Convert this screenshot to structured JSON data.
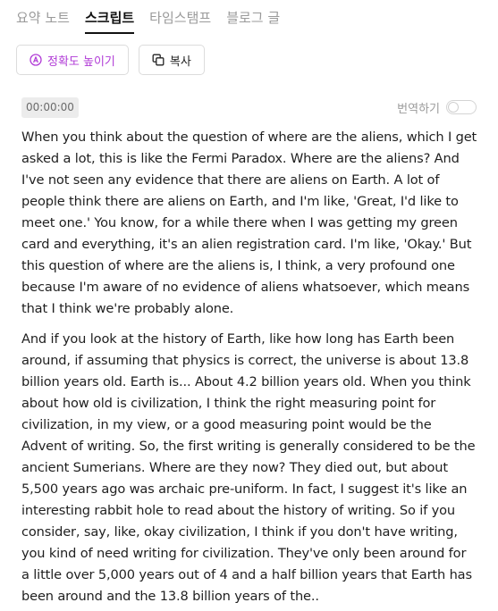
{
  "tabs": [
    {
      "label": "요약 노트",
      "active": false
    },
    {
      "label": "스크립트",
      "active": true
    },
    {
      "label": "타임스탬프",
      "active": false
    },
    {
      "label": "블로그 글",
      "active": false
    }
  ],
  "actions": {
    "accuracy_label": "정확도 높이기",
    "copy_label": "복사"
  },
  "timestamp": "00:00:00",
  "translate_label": "번역하기",
  "translate_enabled": false,
  "transcript": [
    "When you think about the question of where are the aliens, which I get asked a lot, this is like the Fermi Paradox. Where are the aliens? And I've not seen any evidence that there are aliens on Earth. A lot of people think there are aliens on Earth, and I'm like, 'Great, I'd like to meet one.' You know, for a while there when I was getting my green card and everything, it's an alien registration card. I'm like, 'Okay.' But this question of where are the aliens is, I think, a very profound one because I'm aware of no evidence of aliens whatsoever, which means that I think we're probably alone.",
    "And if you look at the history of Earth, like how long has Earth been around, if assuming that physics is correct, the universe is about 13.8 billion years old. Earth is... About 4.2 billion years old. When you think about how old is civilization, I think the right measuring point for civilization, in my view, or a good measuring point would be the Advent of writing. So, the first writing is generally considered to be the ancient Sumerians. Where are they now? They died out, but about 5,500 years ago was archaic pre-uniform. In fact, I suggest it's like an interesting rabbit hole to read about the history of writing. So if you consider, say, like, okay civilization, I think if you don't have writing, you kind of need writing for civilization. They've only been around for a little over 5,000 years out of 4 and a half billion years that Earth has been around and the 13.8 billion years of the.."
  ],
  "colors": {
    "accent": "#b03ad6",
    "active_tab": "#111111",
    "inactive_tab": "#9a9a9a"
  },
  "icons": {
    "accuracy": "a-circle-icon",
    "copy": "copy-icon"
  }
}
